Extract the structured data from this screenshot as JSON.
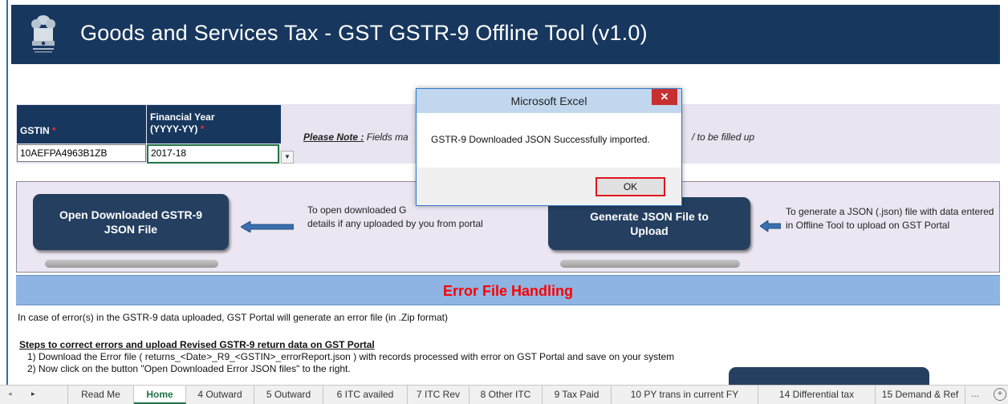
{
  "header": {
    "title": "Goods and Services Tax - GST GSTR-9 Offline Tool (v1.0)"
  },
  "form": {
    "gstin_label": "GSTIN",
    "required_mark": "*",
    "gstin_value": "10AEFPA4963B1ZB",
    "fy_label_line1": "Financial Year",
    "fy_label_line2": "(YYYY-YY)",
    "fy_value": "2017-18",
    "note_label": "Please Note :",
    "note_text": "Fields ma",
    "note_tail": "/ to be filled up"
  },
  "actions": {
    "open_button_line1": "Open Downloaded GSTR-9",
    "open_button_line2": "JSON File",
    "open_help_line1": "To open downloaded G",
    "open_help_line2": "details if any uploaded by you from portal",
    "generate_button_line1": "Generate JSON File to",
    "generate_button_line2": "Upload",
    "generate_help": "To generate a JSON (.json) file with data entered in Offline Tool to upload on GST Portal"
  },
  "error_section": {
    "title": "Error File Handling",
    "intro": "In case of error(s) in the GSTR-9 data uploaded, GST Portal will generate an error file (in .Zip format)",
    "steps_heading": "Steps to correct errors and upload Revised GSTR-9 return data on GST Portal",
    "step1": "1) Download the Error file  ( returns_<Date>_R9_<GSTIN>_errorReport.json ) with records processed with error on GST Portal and save on your system",
    "step2": "2) Now click on the button \"Open Downloaded Error JSON files\" to the right."
  },
  "dialog": {
    "title": "Microsoft Excel",
    "close_glyph": "✕",
    "message": "GSTR-9 Downloaded JSON Successfully imported.",
    "ok_label": "OK"
  },
  "tabs": {
    "nav_prev": "◂",
    "nav_next": "▸",
    "items": [
      "Read Me",
      "Home",
      "4 Outward",
      "5 Outward",
      "6 ITC availed",
      "7 ITC Rev",
      "8 Other ITC",
      "9 Tax Paid",
      "10 PY trans in current FY",
      "14 Differential tax",
      "15 Demand & Ref"
    ],
    "active_index": 1,
    "more": "...",
    "add": "+"
  },
  "colors": {
    "header_bg": "#17375e",
    "button_bg": "#243f60",
    "error_band": "#8db4e2",
    "error_title": "#ff0000",
    "active_tab": "#1e7145"
  }
}
